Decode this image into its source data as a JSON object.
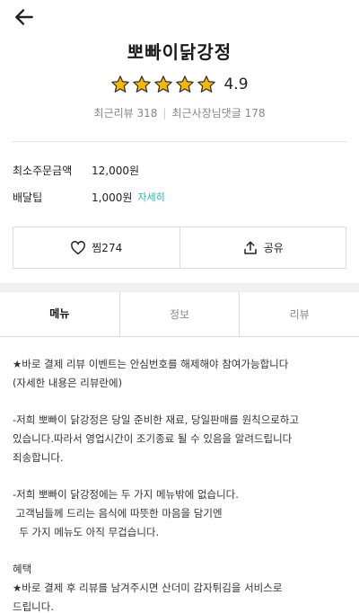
{
  "shop": {
    "name": "뽀빠이닭강정",
    "rating": "4.9",
    "review_count_label": "최근리뷰 318",
    "owner_reply_label": "최근사장님댓글 178"
  },
  "info": {
    "min_order_label": "최소주문금액",
    "min_order_value": "12,000원",
    "delivery_tip_label": "배달팁",
    "delivery_tip_value": "1,000원",
    "delivery_tip_detail": "자세히"
  },
  "actions": {
    "like_label": "찜274",
    "share_label": "공유"
  },
  "tabs": [
    {
      "label": "메뉴"
    },
    {
      "label": "정보"
    },
    {
      "label": "리뷰"
    }
  ],
  "notice": {
    "line1": "★바로 결제 리뷰 이벤트는 안심번호를 해제해야 참여가능합니다",
    "line2": "(자세한 내용은 리뷰란에)",
    "line3": "-저희 뽀빠이 닭강정은 당일 준비한 재료, 당일판매를 원칙으로하고",
    "line4": "있습니다.따라서 영업시간이 조기종료 될 수 있음을 알려드립니다",
    "line5": "죄송합니다.",
    "line6": "-저희 뽀빠이 닭강정에는 두 가지 메뉴밖에 없습니다.",
    "line7": " 고객님들께 드리는 음식에 따뜻한 마음을 담기엔",
    "line8": "  두 가지 메뉴도 아직 무겁습니다.",
    "line9": "혜택",
    "line10": "★바로 결제 후 리뷰를 남겨주시면 산더미 감자튀김을 서비스로",
    "line11": "드립니다."
  },
  "colors": {
    "star": "#f5b800",
    "star_outline": "#333333",
    "link": "#2ab3b3"
  },
  "icons": {
    "back": "arrow-left-icon",
    "star": "star-icon",
    "like": "heart-icon",
    "share": "share-icon"
  }
}
